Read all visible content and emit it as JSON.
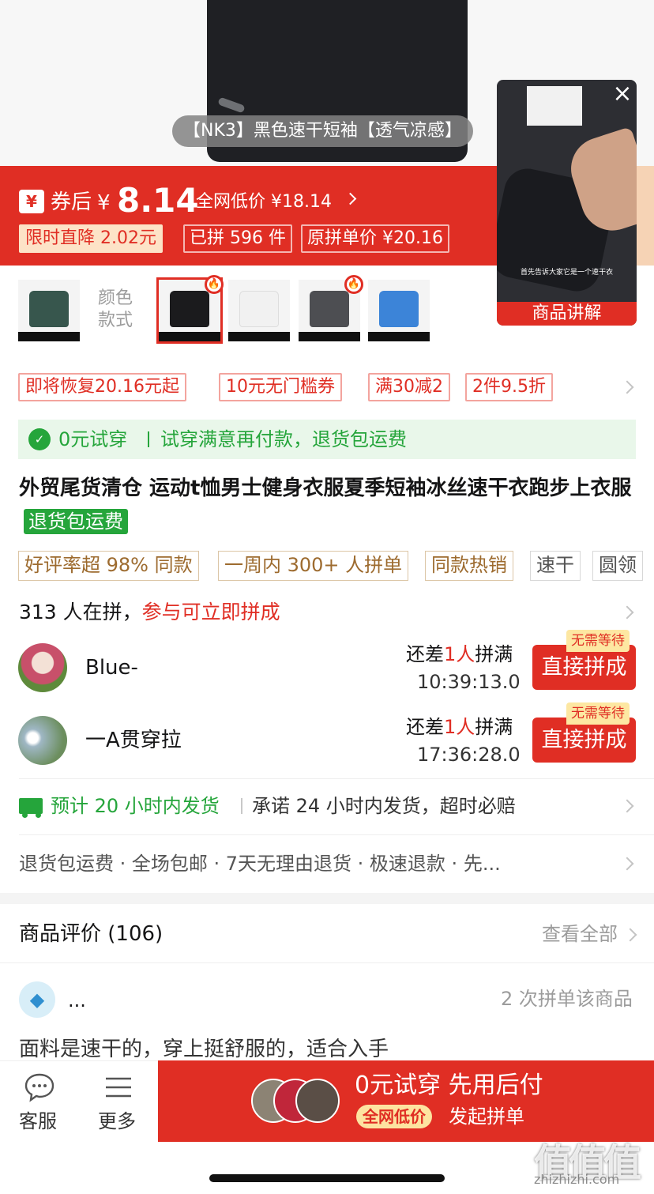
{
  "hero": {
    "label": "【NK3】黑色速干短袖【透气凉感】"
  },
  "price": {
    "yen_icon": "¥",
    "after_coupon": "券后",
    "currency": "¥",
    "amount": "8.14",
    "lowest_text": "全网低价 ¥18.14",
    "tags": [
      "限时直降 2.02元",
      "已拼 596 件",
      "原拼单价 ¥20.16"
    ]
  },
  "video": {
    "caption": "首先告诉大家它是一个速干衣",
    "label": "商品讲解",
    "close": "×"
  },
  "sku": {
    "label": "颜色款式",
    "colors": [
      "#37564d",
      "#1b1b1d",
      "#f1f1f1",
      "#4d4e52",
      "#3c84d8"
    ],
    "hot_badge": "🔥"
  },
  "promos": [
    "即将恢复20.16元起",
    "10元无门槛券",
    "满30减2",
    "2件9.5折"
  ],
  "tryfree": {
    "left": "0元试穿",
    "right": "试穿满意再付款，退货包运费"
  },
  "title": {
    "text": "外贸尾货清仓 运动t恤男士健身衣服夏季短袖冰丝速干衣跑步上衣服",
    "badge": "退货包运费"
  },
  "features": [
    "好评率超 98% 同款",
    "一周内 300+ 人拼单",
    "同款热销",
    "速干",
    "圆领"
  ],
  "group_buy": {
    "count_text": "313 人在拼，",
    "cta_text": "参与可立即拼成",
    "entries": [
      {
        "name": "Blue-",
        "need_prefix": "还差",
        "need_num": "1人",
        "need_suffix": "拼满",
        "time": "10:39:13.0",
        "button": "直接拼成",
        "badge": "无需等待"
      },
      {
        "name": "一A贯穿拉",
        "need_prefix": "还差",
        "need_num": "1人",
        "need_suffix": "拼满",
        "time": "17:36:28.0",
        "button": "直接拼成",
        "badge": "无需等待"
      }
    ]
  },
  "shipping": {
    "green": "预计 20 小时内发货",
    "grey": "承诺 24 小时内发货，超时必赔"
  },
  "services": "退货包运费 · 全场包邮 · 7天无理由退货 · 极速退款 · 先...",
  "reviews": {
    "title": "商品评价 (106)",
    "view_all": "查看全部",
    "first": {
      "name": "...",
      "count": "2 次拼单该商品",
      "text": "面料是速干的，穿上挺舒服的，适合入手"
    }
  },
  "bottom": {
    "service_label": "客服",
    "more_label": "更多",
    "main_title": "0元试穿 先用后付",
    "pill": "全网低价",
    "sub": "发起拼单"
  },
  "watermark": {
    "text": "值值值",
    "url": "zhizhizhi.com"
  },
  "colors": {
    "brand_red": "#e02e24",
    "green": "#25a53b"
  }
}
